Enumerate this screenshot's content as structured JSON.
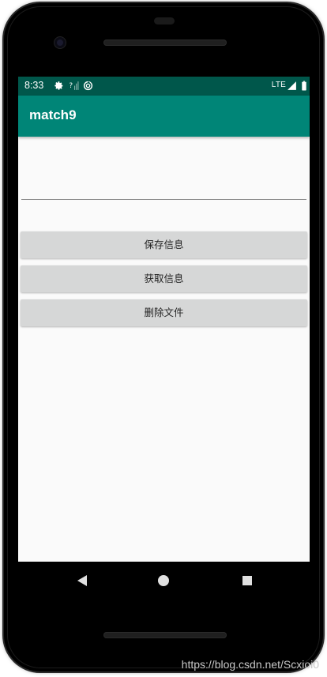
{
  "status_bar": {
    "time": "8:33",
    "network": "LTE",
    "icons": [
      "gear-icon",
      "no-signal-icon",
      "sync-icon",
      "signal-icon",
      "battery-icon"
    ]
  },
  "app_bar": {
    "title": "match9"
  },
  "input": {
    "value": "",
    "placeholder": ""
  },
  "buttons": {
    "save_label": "保存信息",
    "get_label": "获取信息",
    "delete_label": "删除文件"
  },
  "nav_bar": {
    "icons": [
      "back-icon",
      "home-icon",
      "recents-icon"
    ]
  },
  "watermark": {
    "text": "https://blog.csdn.net/Scxioi0"
  },
  "colors": {
    "status_bar": "#00574b",
    "app_bar": "#008577",
    "button_bg": "#d6d7d7",
    "screen_bg": "#fafafa"
  }
}
